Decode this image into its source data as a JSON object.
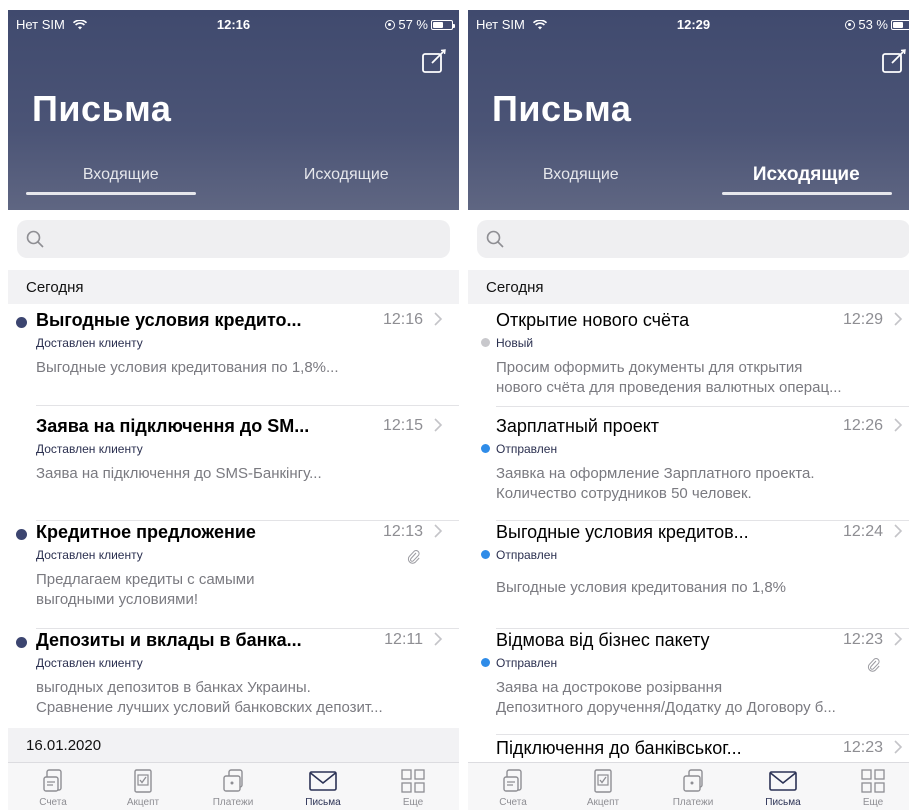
{
  "screens": [
    {
      "status": {
        "carrier": "Нет SIM",
        "time": "12:16",
        "battery": "57 %",
        "battery_level": 0.57
      },
      "title": "Письма",
      "tabs": {
        "inbox": "Входящие",
        "outbox": "Исходящие",
        "active": "inbox"
      },
      "sections": [
        {
          "label": "Сегодня"
        },
        {
          "label": "16.01.2020"
        }
      ],
      "messages": [
        {
          "subject": "Выгодные условия кредито...",
          "time": "12:16",
          "status": "Доставлен клиенту",
          "preview": "Выгодные условия кредитования по 1,8%...",
          "unread": true
        },
        {
          "subject": "Заява на підключення до SM...",
          "time": "12:15",
          "status": "Доставлен клиенту",
          "preview": "Заява на підключення до SMS-Банкінгу...",
          "unread": false
        },
        {
          "subject": "Кредитное предложение",
          "time": "12:13",
          "status": "Доставлен клиенту",
          "preview": "Предлагаем кредиты с самыми\nвыгодными условиями!",
          "unread": true,
          "attachment": true
        },
        {
          "subject": "Депозиты и вклады в банка...",
          "time": "12:11",
          "status": "Доставлен клиенту",
          "preview": "выгодных депозитов в банках Украины.\nСравнение лучших условий банковских депозит...",
          "unread": true
        }
      ],
      "tabbar": [
        "Счета",
        "Акцепт",
        "Платежи",
        "Письма",
        "Еще"
      ]
    },
    {
      "status": {
        "carrier": "Нет SIM",
        "time": "12:29",
        "battery": "53 %",
        "battery_level": 0.53
      },
      "title": "Письма",
      "tabs": {
        "inbox": "Входящие",
        "outbox": "Исходящие",
        "active": "outbox"
      },
      "sections": [
        {
          "label": "Сегодня"
        }
      ],
      "messages": [
        {
          "subject": "Открытие нового счёта",
          "time": "12:29",
          "status": "Новый",
          "status_color": "#c8c8cc",
          "preview": "Просим оформить документы для открытия\nнового счёта для проведения валютных операц..."
        },
        {
          "subject": "Зарплатный проект",
          "time": "12:26",
          "status": "Отправлен",
          "status_color": "#2f8ce8",
          "preview": "Заявка на оформление Зарплатного проекта.\nКоличество сотрудников 50 человек."
        },
        {
          "subject": "Выгодные условия кредитов...",
          "time": "12:24",
          "status": "Отправлен",
          "status_color": "#2f8ce8",
          "preview": "Выгодные условия кредитования по 1,8%"
        },
        {
          "subject": "Відмова від бізнес пакету",
          "time": "12:23",
          "status": "Отправлен",
          "status_color": "#2f8ce8",
          "preview": "Заява на дострокове розірвання\nДепозитного доручення/Додатку до Договору б...",
          "attachment": true
        },
        {
          "subject": "Підключення до банківськог...",
          "time": "12:23"
        }
      ],
      "tabbar": [
        "Счета",
        "Акцепт",
        "Платежи",
        "Письма",
        "Еще"
      ]
    }
  ],
  "colors": {
    "header_top": "#404a6e",
    "header_bottom": "#5f6682",
    "unread_dot": "#3c4570",
    "active_tab": "#2b3255"
  },
  "icons": {
    "compose": "compose-icon",
    "search": "search-icon",
    "chevron": "chevron-right-icon",
    "attachment": "paperclip-icon",
    "tabbar": [
      "accounts-icon",
      "accept-icon",
      "payments-icon",
      "mail-icon",
      "more-icon"
    ]
  }
}
